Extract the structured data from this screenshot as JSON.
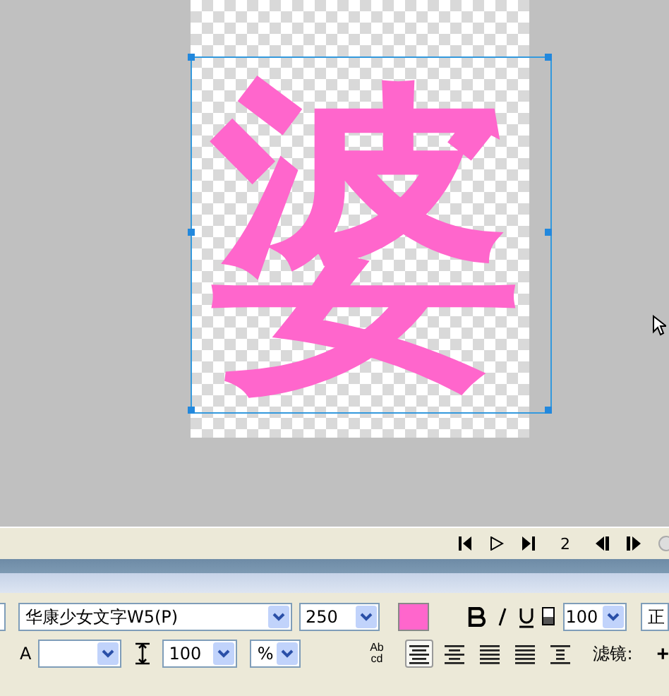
{
  "canvas": {
    "text": "婆",
    "color": "#ff66cc",
    "selected": true
  },
  "playback": {
    "frame": "2"
  },
  "properties": {
    "font": "华康少女文字W5(P)",
    "size": "250",
    "color": "#ff66cc",
    "opacity": "100",
    "style_cut": "正",
    "kerning_label": "A",
    "leading": "100",
    "leading_unit": "%",
    "orientation": [
      "Ab",
      "cd"
    ],
    "alignment": [
      {
        "selected": true
      },
      {
        "selected": false
      },
      {
        "selected": false
      },
      {
        "selected": false
      },
      {
        "selected": false
      }
    ],
    "filters_label": "滤镜:",
    "add_filter": "+"
  }
}
